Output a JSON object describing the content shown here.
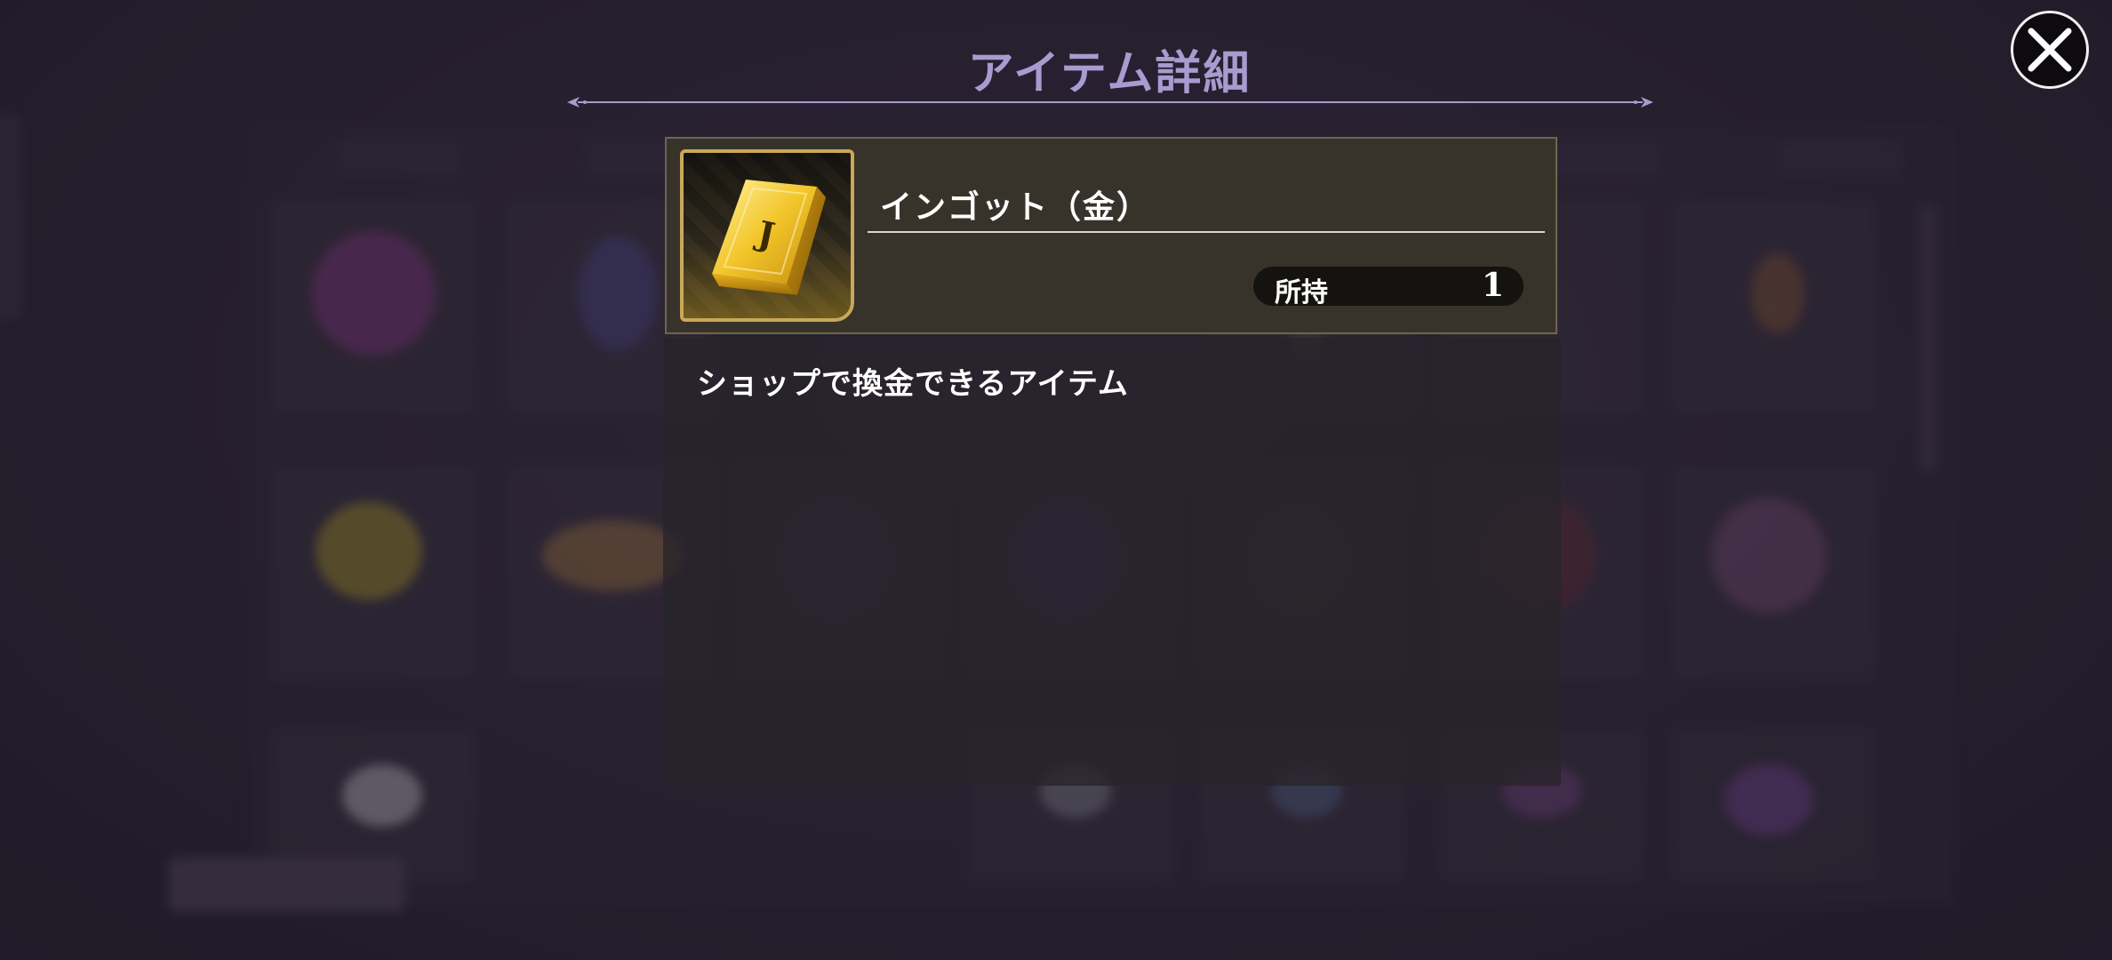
{
  "header": {
    "title": "アイテム詳細"
  },
  "item": {
    "name": "インゴット（金）",
    "owned_label": "所持",
    "owned_count": "1",
    "description": "ショップで換金できるアイテム",
    "icon": "gold-ingot-icon",
    "icon_letter": "J"
  },
  "colors": {
    "title": "#a79bd0",
    "header_bg": "#38332a",
    "header_border": "#6e664c",
    "icon_frame": "#c9a85a",
    "gold": "#e7b924"
  },
  "close_button": {
    "icon": "close-icon"
  }
}
